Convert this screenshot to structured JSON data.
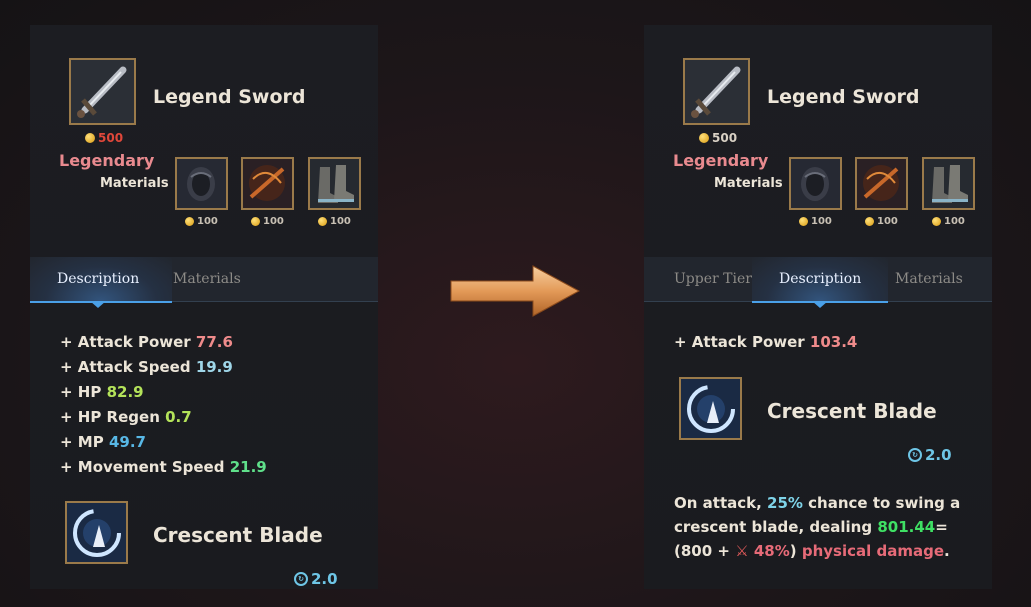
{
  "left_panel": {
    "item_name": "Legend Sword",
    "price": "500",
    "rarity": "Legendary",
    "materials_label": "Materials",
    "materials": [
      {
        "name": "orb-icon",
        "price": "100"
      },
      {
        "name": "crossbow-icon",
        "price": "100"
      },
      {
        "name": "boots-icon",
        "price": "100"
      }
    ],
    "tabs": [
      {
        "label": "Description",
        "active": true
      },
      {
        "label": "Materials",
        "active": false
      }
    ],
    "stats": [
      {
        "label": "+ Attack Power",
        "value": "77.6",
        "color": "#ef8b8b"
      },
      {
        "label": "+ Attack Speed",
        "value": "19.9",
        "color": "#9fd6e8"
      },
      {
        "label": "+ HP",
        "value": "82.9",
        "color": "#b4e35a"
      },
      {
        "label": "+ HP Regen",
        "value": "0.7",
        "color": "#b4e35a"
      },
      {
        "label": "+ MP",
        "value": "49.7",
        "color": "#58b8e6"
      },
      {
        "label": "+ Movement Speed",
        "value": "21.9",
        "color": "#5fe08a"
      }
    ],
    "skill": {
      "name": "Crescent Blade",
      "cooldown": "2.0"
    }
  },
  "right_panel": {
    "item_name": "Legend Sword",
    "price": "500",
    "rarity": "Legendary",
    "materials_label": "Materials",
    "materials": [
      {
        "name": "orb-icon",
        "price": "100"
      },
      {
        "name": "crossbow-icon",
        "price": "100"
      },
      {
        "name": "boots-icon",
        "price": "100"
      }
    ],
    "tabs": [
      {
        "label": "Upper Tier",
        "active": false
      },
      {
        "label": "Description",
        "active": true
      },
      {
        "label": "Materials",
        "active": false
      }
    ],
    "stats": [
      {
        "label": "+ Attack Power",
        "value": "103.4",
        "color": "#ef8b8b"
      }
    ],
    "skill": {
      "name": "Crescent Blade",
      "cooldown": "2.0"
    },
    "description": {
      "p1": "On attack, ",
      "chance": "25%",
      "p2": " chance to  swing a crescent blade, dealing ",
      "damage": "801.44",
      "p3": "=(800 + ",
      "scale": "48%",
      "p4": ") ",
      "dmg_type": "physical damage",
      "p5": "."
    }
  },
  "arrow": {
    "icon": "right-arrow-icon",
    "color": "#e8a060"
  }
}
